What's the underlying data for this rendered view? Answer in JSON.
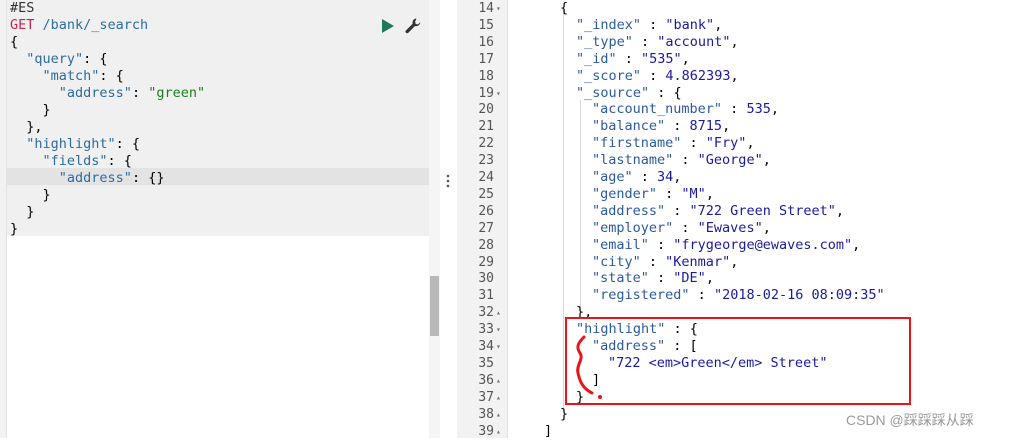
{
  "left_editor": {
    "lines": [
      {
        "id": "l1",
        "parts": [
          {
            "t": "#ES",
            "c": "c-comment"
          }
        ]
      },
      {
        "id": "l2",
        "parts": [
          {
            "t": "GET",
            "c": "c-method"
          },
          {
            "t": " /bank/_search",
            "c": "c-path"
          }
        ]
      },
      {
        "id": "l3",
        "parts": [
          {
            "t": "{",
            "c": "c-punc"
          }
        ]
      },
      {
        "id": "l4",
        "parts": [
          {
            "t": "  ",
            "c": "c-punc"
          },
          {
            "t": "\"query\"",
            "c": "c-key"
          },
          {
            "t": ": {",
            "c": "c-punc"
          }
        ]
      },
      {
        "id": "l5",
        "parts": [
          {
            "t": "    ",
            "c": "c-punc"
          },
          {
            "t": "\"match\"",
            "c": "c-key"
          },
          {
            "t": ": {",
            "c": "c-punc"
          }
        ]
      },
      {
        "id": "l6",
        "parts": [
          {
            "t": "      ",
            "c": "c-punc"
          },
          {
            "t": "\"address\"",
            "c": "c-key"
          },
          {
            "t": ": ",
            "c": "c-punc"
          },
          {
            "t": "\"green\"",
            "c": "c-str"
          }
        ]
      },
      {
        "id": "l7",
        "parts": [
          {
            "t": "    }",
            "c": "c-punc"
          }
        ]
      },
      {
        "id": "l8",
        "parts": [
          {
            "t": "  },",
            "c": "c-punc"
          }
        ]
      },
      {
        "id": "l9",
        "parts": [
          {
            "t": "  ",
            "c": "c-punc"
          },
          {
            "t": "\"highlight\"",
            "c": "c-key"
          },
          {
            "t": ": {",
            "c": "c-punc"
          }
        ]
      },
      {
        "id": "l10",
        "parts": [
          {
            "t": "    ",
            "c": "c-punc"
          },
          {
            "t": "\"fields\"",
            "c": "c-key"
          },
          {
            "t": ": {",
            "c": "c-punc"
          }
        ]
      },
      {
        "id": "l11",
        "parts": [
          {
            "t": "      ",
            "c": "c-punc"
          },
          {
            "t": "\"address\"",
            "c": "c-key"
          },
          {
            "t": ": {}",
            "c": "c-punc"
          }
        ]
      },
      {
        "id": "l12",
        "parts": [
          {
            "t": "    }",
            "c": "c-punc"
          }
        ]
      },
      {
        "id": "l13",
        "parts": [
          {
            "t": "  }",
            "c": "c-punc"
          }
        ]
      },
      {
        "id": "l14",
        "parts": [
          {
            "t": "}",
            "c": "c-punc"
          }
        ]
      }
    ],
    "run_button_icon": "play-icon",
    "settings_button_icon": "wrench-icon"
  },
  "right_result": {
    "line_numbers": [
      "14",
      "15",
      "16",
      "17",
      "18",
      "19",
      "20",
      "21",
      "22",
      "23",
      "24",
      "25",
      "26",
      "27",
      "28",
      "29",
      "30",
      "31",
      "32",
      "33",
      "34",
      "35",
      "36",
      "37",
      "38",
      "39"
    ],
    "fold_markers": {
      "14": "▾",
      "19": "▾",
      "32": "▴",
      "33": "▾",
      "34": "▾",
      "36": "▴",
      "37": "▴",
      "38": "▴",
      "39": "▴"
    },
    "lines": [
      {
        "n": "14",
        "indent": 0,
        "parts": [
          {
            "t": "{",
            "c": ""
          }
        ]
      },
      {
        "n": "15",
        "indent": 1,
        "parts": [
          {
            "t": "\"_index\"",
            "c": "r-key"
          },
          {
            "t": " : ",
            "c": ""
          },
          {
            "t": "\"bank\"",
            "c": "r-str"
          },
          {
            "t": ",",
            "c": ""
          }
        ]
      },
      {
        "n": "16",
        "indent": 1,
        "parts": [
          {
            "t": "\"_type\"",
            "c": "r-key"
          },
          {
            "t": " : ",
            "c": ""
          },
          {
            "t": "\"account\"",
            "c": "r-str"
          },
          {
            "t": ",",
            "c": ""
          }
        ]
      },
      {
        "n": "17",
        "indent": 1,
        "parts": [
          {
            "t": "\"_id\"",
            "c": "r-key"
          },
          {
            "t": " : ",
            "c": ""
          },
          {
            "t": "\"535\"",
            "c": "r-str"
          },
          {
            "t": ",",
            "c": ""
          }
        ]
      },
      {
        "n": "18",
        "indent": 1,
        "parts": [
          {
            "t": "\"_score\"",
            "c": "r-key"
          },
          {
            "t": " : ",
            "c": ""
          },
          {
            "t": "4.862393",
            "c": "r-num"
          },
          {
            "t": ",",
            "c": ""
          }
        ]
      },
      {
        "n": "19",
        "indent": 1,
        "parts": [
          {
            "t": "\"_source\"",
            "c": "r-key"
          },
          {
            "t": " : {",
            "c": ""
          }
        ]
      },
      {
        "n": "20",
        "indent": 2,
        "parts": [
          {
            "t": "\"account_number\"",
            "c": "r-key"
          },
          {
            "t": " : ",
            "c": ""
          },
          {
            "t": "535",
            "c": "r-num"
          },
          {
            "t": ",",
            "c": ""
          }
        ]
      },
      {
        "n": "21",
        "indent": 2,
        "parts": [
          {
            "t": "\"balance\"",
            "c": "r-key"
          },
          {
            "t": " : ",
            "c": ""
          },
          {
            "t": "8715",
            "c": "r-num"
          },
          {
            "t": ",",
            "c": ""
          }
        ]
      },
      {
        "n": "22",
        "indent": 2,
        "parts": [
          {
            "t": "\"firstname\"",
            "c": "r-key"
          },
          {
            "t": " : ",
            "c": ""
          },
          {
            "t": "\"Fry\"",
            "c": "r-str"
          },
          {
            "t": ",",
            "c": ""
          }
        ]
      },
      {
        "n": "23",
        "indent": 2,
        "parts": [
          {
            "t": "\"lastname\"",
            "c": "r-key"
          },
          {
            "t": " : ",
            "c": ""
          },
          {
            "t": "\"George\"",
            "c": "r-str"
          },
          {
            "t": ",",
            "c": ""
          }
        ]
      },
      {
        "n": "24",
        "indent": 2,
        "parts": [
          {
            "t": "\"age\"",
            "c": "r-key"
          },
          {
            "t": " : ",
            "c": ""
          },
          {
            "t": "34",
            "c": "r-num"
          },
          {
            "t": ",",
            "c": ""
          }
        ]
      },
      {
        "n": "25",
        "indent": 2,
        "parts": [
          {
            "t": "\"gender\"",
            "c": "r-key"
          },
          {
            "t": " : ",
            "c": ""
          },
          {
            "t": "\"M\"",
            "c": "r-str"
          },
          {
            "t": ",",
            "c": ""
          }
        ]
      },
      {
        "n": "26",
        "indent": 2,
        "parts": [
          {
            "t": "\"address\"",
            "c": "r-key"
          },
          {
            "t": " : ",
            "c": ""
          },
          {
            "t": "\"722 Green Street\"",
            "c": "r-str"
          },
          {
            "t": ",",
            "c": ""
          }
        ]
      },
      {
        "n": "27",
        "indent": 2,
        "parts": [
          {
            "t": "\"employer\"",
            "c": "r-key"
          },
          {
            "t": " : ",
            "c": ""
          },
          {
            "t": "\"Ewaves\"",
            "c": "r-str"
          },
          {
            "t": ",",
            "c": ""
          }
        ]
      },
      {
        "n": "28",
        "indent": 2,
        "parts": [
          {
            "t": "\"email\"",
            "c": "r-key"
          },
          {
            "t": " : ",
            "c": ""
          },
          {
            "t": "\"frygeorge@ewaves.com\"",
            "c": "r-str"
          },
          {
            "t": ",",
            "c": ""
          }
        ]
      },
      {
        "n": "29",
        "indent": 2,
        "parts": [
          {
            "t": "\"city\"",
            "c": "r-key"
          },
          {
            "t": " : ",
            "c": ""
          },
          {
            "t": "\"Kenmar\"",
            "c": "r-str"
          },
          {
            "t": ",",
            "c": ""
          }
        ]
      },
      {
        "n": "30",
        "indent": 2,
        "parts": [
          {
            "t": "\"state\"",
            "c": "r-key"
          },
          {
            "t": " : ",
            "c": ""
          },
          {
            "t": "\"DE\"",
            "c": "r-str"
          },
          {
            "t": ",",
            "c": ""
          }
        ]
      },
      {
        "n": "31",
        "indent": 2,
        "parts": [
          {
            "t": "\"registered\"",
            "c": "r-key"
          },
          {
            "t": " : ",
            "c": ""
          },
          {
            "t": "\"2018-02-16 08:09:35\"",
            "c": "r-str"
          }
        ]
      },
      {
        "n": "32",
        "indent": 1,
        "parts": [
          {
            "t": "},",
            "c": ""
          }
        ]
      },
      {
        "n": "33",
        "indent": 1,
        "parts": [
          {
            "t": "\"highlight\"",
            "c": "r-key"
          },
          {
            "t": " : {",
            "c": ""
          }
        ]
      },
      {
        "n": "34",
        "indent": 2,
        "parts": [
          {
            "t": "\"address\"",
            "c": "r-key"
          },
          {
            "t": " : [",
            "c": ""
          }
        ]
      },
      {
        "n": "35",
        "indent": 3,
        "parts": [
          {
            "t": "\"722 <em>Green</em> Street\"",
            "c": "r-str"
          }
        ]
      },
      {
        "n": "36",
        "indent": 2,
        "parts": [
          {
            "t": "]",
            "c": ""
          }
        ]
      },
      {
        "n": "37",
        "indent": 1,
        "parts": [
          {
            "t": "}",
            "c": ""
          }
        ]
      },
      {
        "n": "38",
        "indent": 0,
        "parts": [
          {
            "t": "}",
            "c": ""
          }
        ]
      },
      {
        "n": "39",
        "indent": -1,
        "parts": [
          {
            "t": "]",
            "c": ""
          }
        ]
      }
    ]
  },
  "annotation": {
    "box_color": "#e8141a",
    "box_label": "highlight-section"
  },
  "watermark": "CSDN @踩踩踩从踩"
}
